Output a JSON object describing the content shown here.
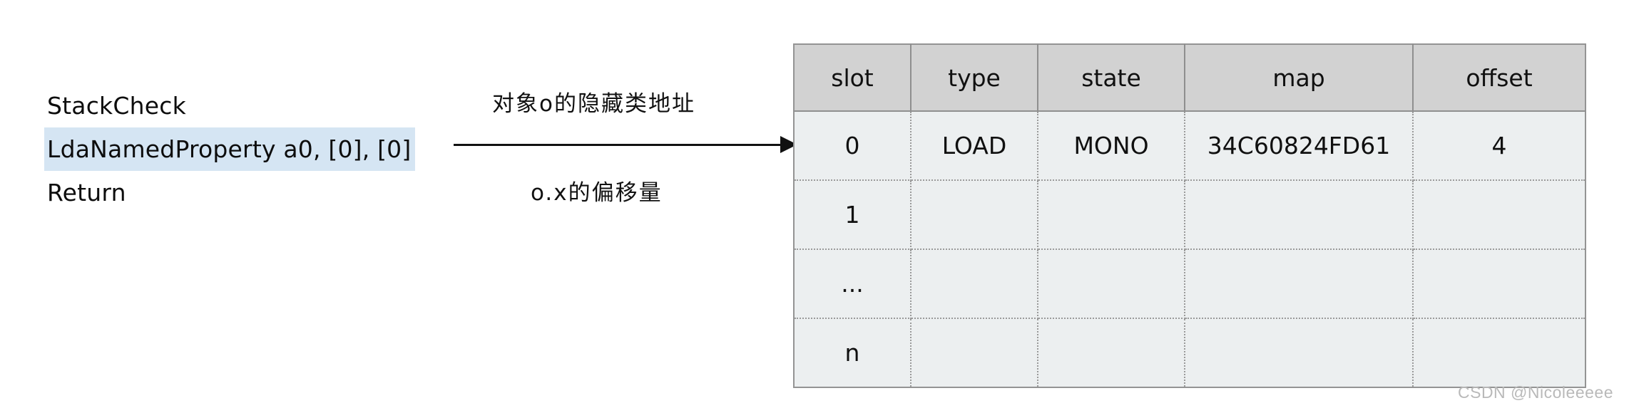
{
  "code_listing": {
    "lines": [
      {
        "text": "StackCheck",
        "highlighted": false
      },
      {
        "text": "LdaNamedProperty a0, [0], [0]",
        "highlighted": true
      },
      {
        "text": "Return",
        "highlighted": false
      }
    ],
    "highlight_color": "#d5e5f3"
  },
  "annotations": {
    "top": "对象o的隐藏类地址",
    "bottom": "o.x的偏移量"
  },
  "arrow": {
    "name": "arrow-right",
    "color": "#111111"
  },
  "table": {
    "headers": [
      "slot",
      "type",
      "state",
      "map",
      "offset"
    ],
    "rows": [
      {
        "slot": "0",
        "type": "LOAD",
        "state": "MONO",
        "map": "34C60824FD61",
        "offset": "4"
      },
      {
        "slot": "1",
        "type": "",
        "state": "",
        "map": "",
        "offset": ""
      },
      {
        "slot": "...",
        "type": "",
        "state": "",
        "map": "",
        "offset": ""
      },
      {
        "slot": "n",
        "type": "",
        "state": "",
        "map": "",
        "offset": ""
      }
    ],
    "header_bg": "#d2d2d2",
    "body_bg": "#eceff0",
    "border_color": "#949494"
  },
  "watermark": {
    "text": "CSDN @Nicoleeeee"
  }
}
